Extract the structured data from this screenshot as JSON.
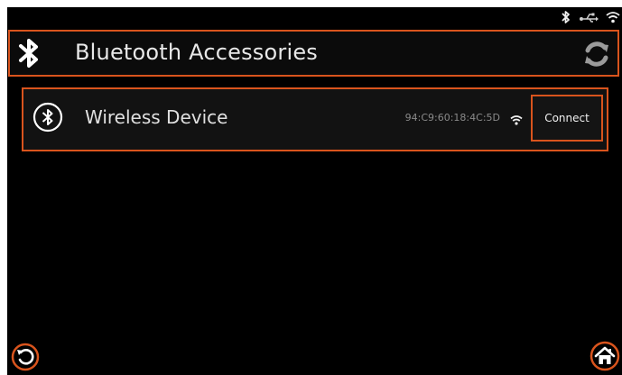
{
  "header": {
    "title": "Bluetooth Accessories",
    "icon": "bluetooth-icon",
    "refresh_icon": "refresh-icon"
  },
  "status_bar": {
    "icons": [
      "bluetooth-icon",
      "usb-icon",
      "wifi-icon"
    ]
  },
  "devices": [
    {
      "name": "Wireless Device",
      "mac": "94:C9:60:18:4C:5D",
      "icon": "bluetooth-circle-icon",
      "signal_icon": "wifi-signal-icon",
      "action_label": "Connect"
    }
  ],
  "footer": {
    "back_icon": "back-icon",
    "home_icon": "home-icon"
  },
  "colors": {
    "accent": "#d9541d",
    "background": "#000000",
    "text": "#e8e8e8",
    "muted_text": "#8a8a8a"
  }
}
